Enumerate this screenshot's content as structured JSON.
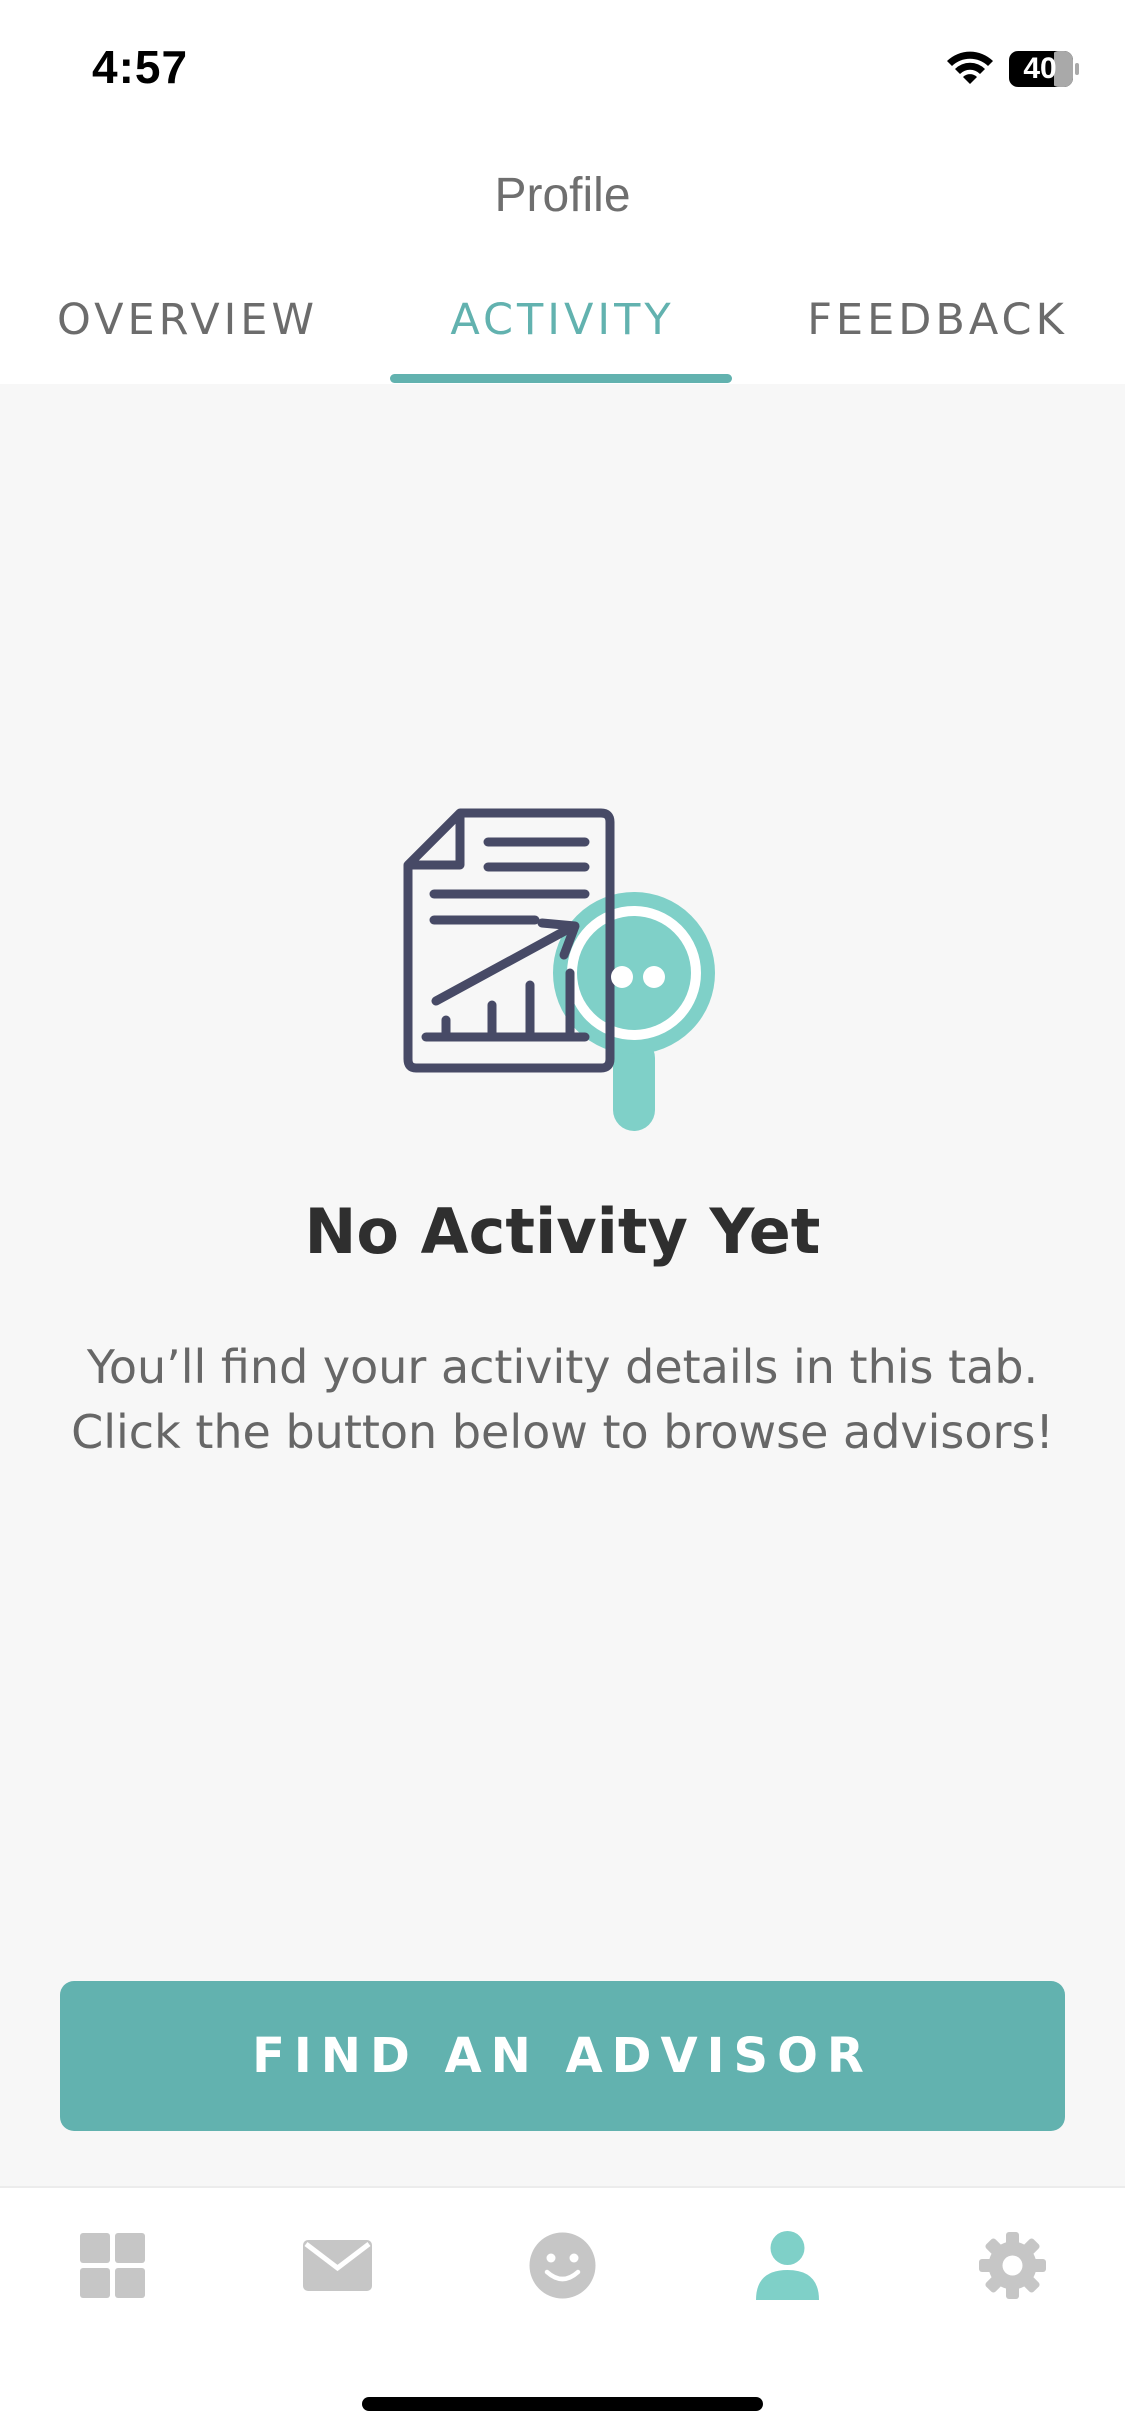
{
  "status_bar": {
    "time": "4:57",
    "battery": "40"
  },
  "header": {
    "title": "Profile",
    "tabs": [
      {
        "label": "OVERVIEW",
        "active": false
      },
      {
        "label": "ACTIVITY",
        "active": true
      },
      {
        "label": "FEEDBACK",
        "active": false
      }
    ]
  },
  "empty_state": {
    "title": "No Activity Yet",
    "message": "You’ll find your activity details in this tab. Click the button below to browse advisors!"
  },
  "cta": {
    "label": "FIND AN ADVISOR"
  },
  "tab_bar": {
    "items": [
      "dashboard-icon",
      "mail-icon",
      "smiley-icon",
      "profile-icon",
      "settings-icon"
    ],
    "active_item": "profile-icon"
  },
  "colors": {
    "accent": "#62b2af",
    "illustration_dark": "#474a66",
    "illustration_teal": "#7fd0c8",
    "inactive_icon": "#c6c6c6"
  }
}
